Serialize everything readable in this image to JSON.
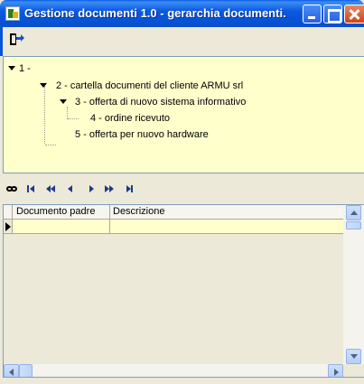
{
  "window": {
    "title": "Gestione documenti 1.0 - gerarchia documenti..."
  },
  "tree": {
    "nodes": [
      {
        "label": "1 -"
      },
      {
        "label": "2 - cartella documenti del cliente ARMU srl"
      },
      {
        "label": "3 - offerta di nuovo sistema informativo"
      },
      {
        "label": "4 - ordine ricevuto"
      },
      {
        "label": "5 - offerta per nuovo hardware"
      }
    ]
  },
  "grid": {
    "columns": [
      "Documento padre",
      "Descrizione"
    ],
    "rows": [
      {
        "documento_padre": "",
        "descrizione": ""
      }
    ]
  },
  "colors": {
    "titlebar": "#0753d8",
    "tree_background": "#ffffcc",
    "window_background": "#ece9d8"
  }
}
